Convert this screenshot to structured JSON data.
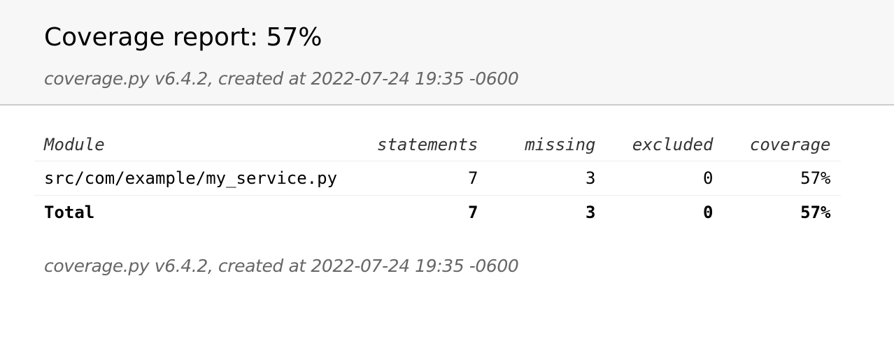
{
  "header": {
    "title": "Coverage report: 57%",
    "created": "coverage.py v6.4.2, created at 2022-07-24 19:35 -0600"
  },
  "table": {
    "columns": {
      "module": "Module",
      "statements": "statements",
      "missing": "missing",
      "excluded": "excluded",
      "coverage": "coverage"
    },
    "rows": [
      {
        "module": "src/com/example/my_service.py",
        "statements": "7",
        "missing": "3",
        "excluded": "0",
        "coverage": "57%"
      }
    ],
    "total": {
      "label": "Total",
      "statements": "7",
      "missing": "3",
      "excluded": "0",
      "coverage": "57%"
    }
  },
  "footer": {
    "created": "coverage.py v6.4.2, created at 2022-07-24 19:35 -0600"
  }
}
